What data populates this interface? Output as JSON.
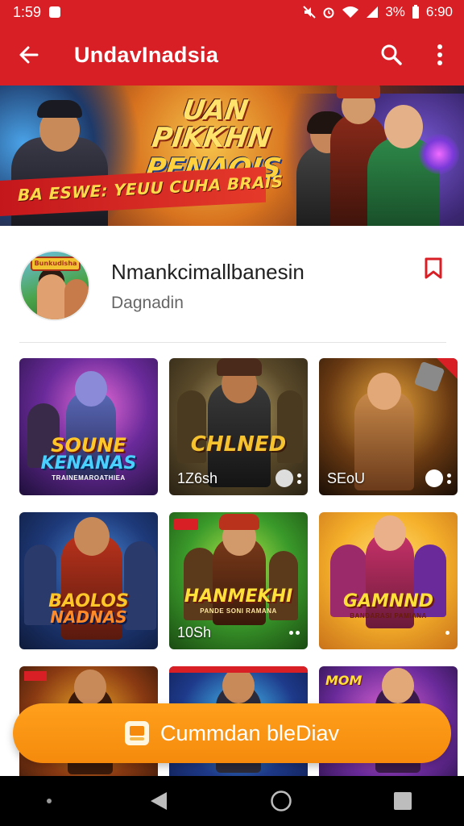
{
  "status_bar": {
    "time": "1:59",
    "battery": "3%",
    "clock": "6:90"
  },
  "app_bar": {
    "title": "UndavInadsia"
  },
  "banner": {
    "title_line1": "UAN PIKKHN",
    "title_line2": "PENAOIS",
    "tagline": "BA ESWE: YEUU CUHA BRAIS"
  },
  "channel": {
    "name": "Nmankcimallbanesin",
    "subtitle": "Dagnadin",
    "avatar_logo": "Bunkudisha"
  },
  "tiles": [
    {
      "title": "SOUNE",
      "title2": "KENANAS",
      "sub": "TRAINEMAROATHIEA",
      "meta": "",
      "palette": "purple"
    },
    {
      "title": "CHLNED",
      "title2": "",
      "sub": "",
      "meta": "1Z6sh",
      "palette": "bronze"
    },
    {
      "title": "",
      "title2": "",
      "sub": "",
      "meta": "SEoU",
      "palette": "gold"
    },
    {
      "title": "BAOLOS",
      "title2": "NADNAS",
      "sub": "",
      "meta": "",
      "palette": "blue"
    },
    {
      "title": "HANMEKHI",
      "title2": "",
      "sub": "PANDE SONI RAMANA",
      "meta": "10Sh",
      "palette": "green"
    },
    {
      "title": "GAMNND",
      "title2": "",
      "sub": "BANDARASI PAMIANA",
      "meta": "",
      "palette": "yellow"
    },
    {
      "title": "",
      "title2": "",
      "sub": "",
      "meta": "",
      "palette": "orange"
    },
    {
      "title": "",
      "title2": "",
      "sub": "",
      "meta": "",
      "palette": "navy"
    },
    {
      "title": "MOM",
      "title2": "",
      "sub": "",
      "meta": "",
      "palette": "pink"
    }
  ],
  "cta": {
    "label": "Cummdan bleDiav"
  },
  "colors": {
    "brand_red": "#d81f26",
    "cta_orange": "#f58a0c"
  }
}
